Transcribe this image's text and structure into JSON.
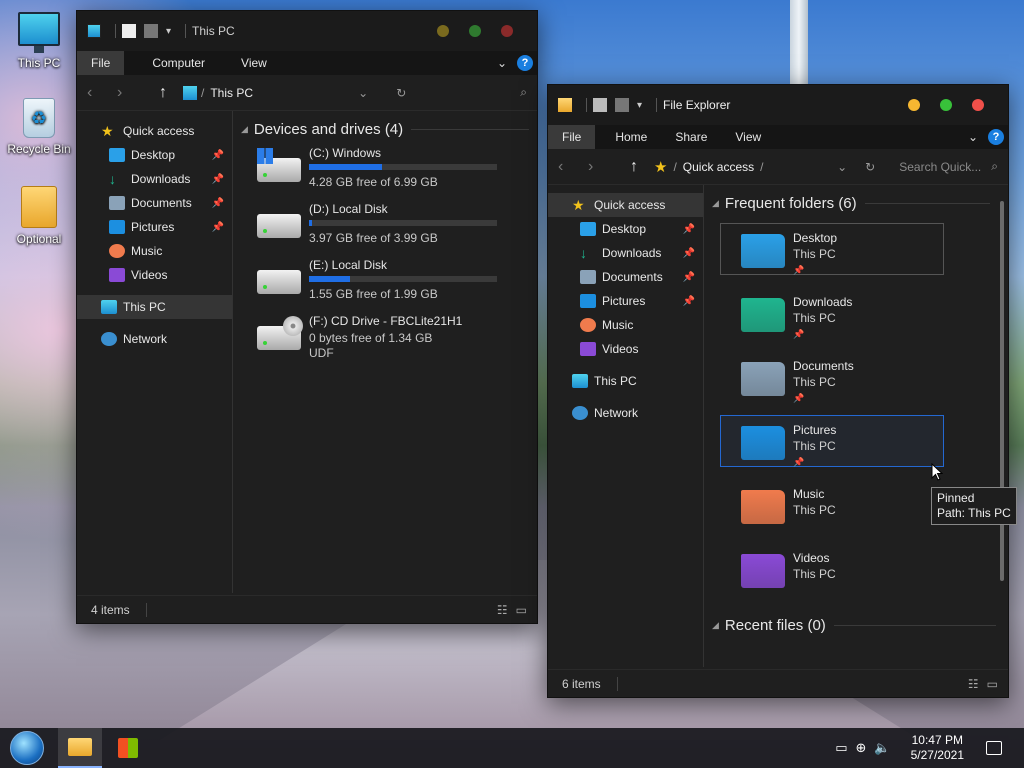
{
  "desktop": {
    "icons": [
      {
        "label": "This PC",
        "icon": "monitor-icon"
      },
      {
        "label": "Recycle Bin",
        "icon": "recycle-bin-icon"
      },
      {
        "label": "Optional",
        "icon": "folder-icon"
      }
    ]
  },
  "win1": {
    "title": "This PC",
    "ribbon": [
      "File",
      "Computer",
      "View"
    ],
    "help": "?",
    "address": "This PC",
    "nav": {
      "quick_access": "Quick access",
      "pinned": [
        "Desktop",
        "Downloads",
        "Documents",
        "Pictures"
      ],
      "other": [
        "Music",
        "Videos"
      ],
      "this_pc": "This PC",
      "network": "Network"
    },
    "group": "Devices and drives (4)",
    "drives": [
      {
        "name": "(C:) Windows",
        "free": "4.28 GB free of 6.99 GB",
        "used_fraction": 0.39
      },
      {
        "name": "(D:) Local Disk",
        "free": "3.97 GB free of 3.99 GB",
        "used_fraction": 0.01
      },
      {
        "name": "(E:) Local Disk",
        "free": "1.55 GB free of 1.99 GB",
        "used_fraction": 0.22
      }
    ],
    "cd": {
      "name": "(F:) CD Drive - FBCLite21H1",
      "free": "0 bytes free of 1.34 GB",
      "fs": "UDF"
    },
    "status": "4 items"
  },
  "win2": {
    "title": "File Explorer",
    "ribbon": [
      "File",
      "Home",
      "Share",
      "View"
    ],
    "help": "?",
    "address": "Quick access",
    "search_placeholder": "Search Quick...",
    "nav": {
      "quick_access": "Quick access",
      "pinned": [
        "Desktop",
        "Downloads",
        "Documents",
        "Pictures"
      ],
      "other": [
        "Music",
        "Videos"
      ],
      "this_pc": "This PC",
      "network": "Network"
    },
    "group_frequent": "Frequent folders (6)",
    "folders": [
      {
        "name": "Desktop",
        "location": "This PC",
        "pinned": true,
        "color": "#2aa0e8"
      },
      {
        "name": "Downloads",
        "location": "This PC",
        "pinned": true,
        "color": "#1fb58f"
      },
      {
        "name": "Documents",
        "location": "This PC",
        "pinned": true,
        "color": "#8aa2b8"
      },
      {
        "name": "Pictures",
        "location": "This PC",
        "pinned": true,
        "color": "#1c8fe0"
      },
      {
        "name": "Music",
        "location": "This PC",
        "pinned": false,
        "color": "#f07b4d"
      },
      {
        "name": "Videos",
        "location": "This PC",
        "pinned": false,
        "color": "#8a4ad6"
      }
    ],
    "group_recent": "Recent files (0)",
    "tooltip": {
      "line1": "Pinned",
      "line2": "Path: This PC"
    },
    "status": "6 items"
  },
  "taskbar": {
    "time": "10:47 PM",
    "date": "5/27/2021"
  }
}
